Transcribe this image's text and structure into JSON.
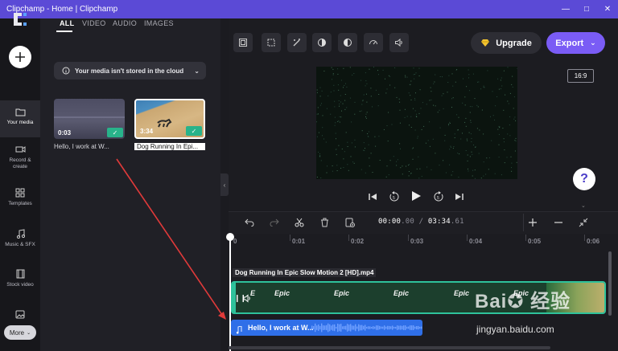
{
  "window": {
    "title": "Clipchamp - Home | Clipchamp",
    "controls": [
      "—",
      "□",
      "✕"
    ]
  },
  "sidebar": {
    "add_icon": "plus-icon",
    "items": [
      {
        "label": "Your media",
        "icon": "folder-icon",
        "active": true
      },
      {
        "label": "Record & create",
        "icon": "camera-icon"
      },
      {
        "label": "Templates",
        "icon": "templates-icon"
      },
      {
        "label": "Music & SFX",
        "icon": "music-icon"
      },
      {
        "label": "Stock video",
        "icon": "film-icon"
      },
      {
        "label": "",
        "icon": "image-icon"
      }
    ],
    "more_label": "More"
  },
  "media": {
    "tabs": [
      "ALL",
      "VIDEO",
      "AUDIO",
      "IMAGES"
    ],
    "active_tab": "ALL",
    "notice": "Your media isn't stored in the cloud",
    "items": [
      {
        "duration": "0:03",
        "caption": "Hello, I work at W..."
      },
      {
        "duration": "3:34",
        "caption": "Dog Running In Epi..."
      }
    ]
  },
  "toolbar": {
    "tools": [
      "crop-fit-icon",
      "crop-icon",
      "magic-icon",
      "contrast-icon",
      "color-icon",
      "speed-icon",
      "volume-icon"
    ],
    "upgrade_label": "Upgrade",
    "export_label": "Export"
  },
  "preview": {
    "aspect_ratio": "16:9",
    "help": "?"
  },
  "playback": {
    "buttons": [
      "skip-back-icon",
      "rewind-5-icon",
      "play-icon",
      "forward-5-icon",
      "skip-forward-icon"
    ]
  },
  "timeline": {
    "time_current_main": "00:00",
    "time_current_frac": ".00",
    "separator": " / ",
    "time_total_main": "03:34",
    "time_total_frac": ".61",
    "ruler_ticks": [
      "0",
      "0:01",
      "0:02",
      "0:03",
      "0:04",
      "0:05",
      "0:06"
    ],
    "video_clip_label": "Dog Running In Epic Slow Motion 2 [HD].mp4",
    "video_clip_words": [
      "E",
      "Epic",
      "Epic",
      "Epic",
      "Epic",
      "Epic"
    ],
    "audio_clip_label": "Hello, I work at W..."
  },
  "watermark": {
    "logo": "Bai✪ 经验",
    "url": "jingyan.baidu.com"
  },
  "colors": {
    "titlebar": "#5b4ad6",
    "accent": "#7a5cf5",
    "clip_border": "#2ec29b",
    "audio_clip": "#2f6fe8",
    "annotation": "#e03a3a"
  }
}
